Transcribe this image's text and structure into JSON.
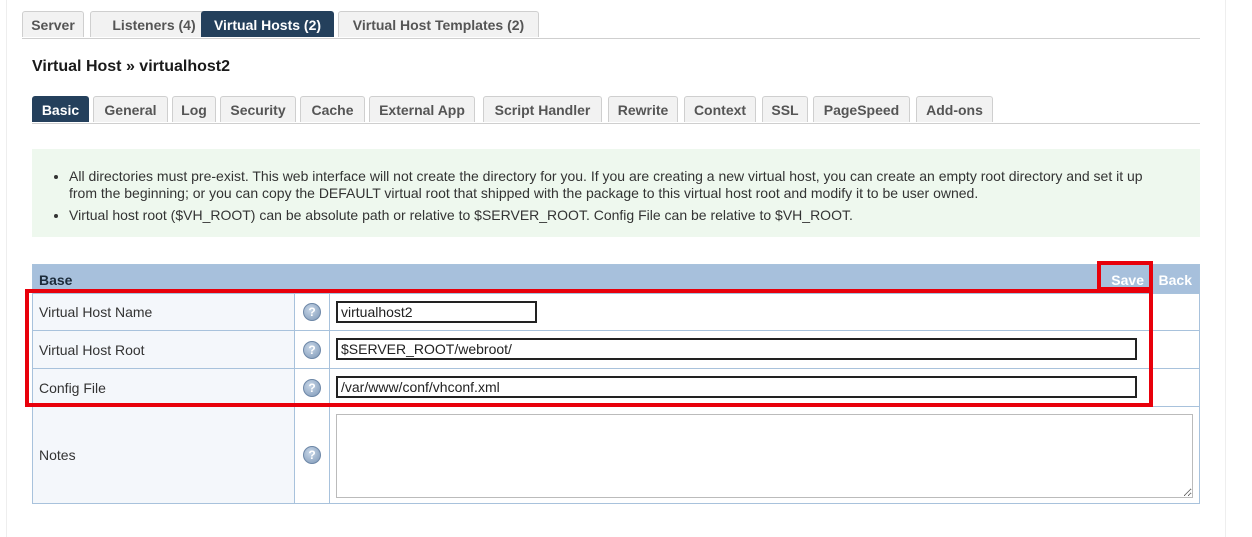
{
  "top_tabs": [
    {
      "label": "Server"
    },
    {
      "label": "Listeners (4)"
    },
    {
      "label": "Virtual Hosts (2)",
      "active": true
    },
    {
      "label": "Virtual Host Templates (2)"
    }
  ],
  "vh_title": {
    "prefix": "Virtual Host » ",
    "name": "virtualhost2"
  },
  "sub_tabs": [
    {
      "label": "Basic",
      "active": true
    },
    {
      "label": "General"
    },
    {
      "label": "Log"
    },
    {
      "label": "Security"
    },
    {
      "label": "Cache"
    },
    {
      "label": "External App"
    },
    {
      "label": "Script Handler"
    },
    {
      "label": "Rewrite"
    },
    {
      "label": "Context"
    },
    {
      "label": "SSL"
    },
    {
      "label": "PageSpeed"
    },
    {
      "label": "Add-ons"
    }
  ],
  "info": {
    "items": [
      "All directories must pre-exist. This web interface will not create the directory for you. If you are creating a new virtual host, you can create an empty root directory and set it up from the beginning; or you can copy the DEFAULT virtual root that shipped with the package to this virtual host root and modify it to be user owned.",
      "Virtual host root ($VH_ROOT) can be absolute path or relative to $SERVER_ROOT. Config File can be relative to $VH_ROOT."
    ]
  },
  "table": {
    "title": "Base",
    "save_label": "Save",
    "back_label": "Back",
    "help_glyph": "?",
    "rows": [
      {
        "label": "Virtual Host Name",
        "value": "virtualhost2"
      },
      {
        "label": "Virtual Host Root",
        "value": "$SERVER_ROOT/webroot/"
      },
      {
        "label": "Config File",
        "value": "/var/www/conf/vhconf.xml"
      },
      {
        "label": "Notes",
        "value": ""
      }
    ]
  },
  "colors": {
    "active_tab": "#24405c",
    "table_header": "#a7c0dc",
    "highlight": "#e8000b",
    "info_bg": "#eef8ee"
  }
}
